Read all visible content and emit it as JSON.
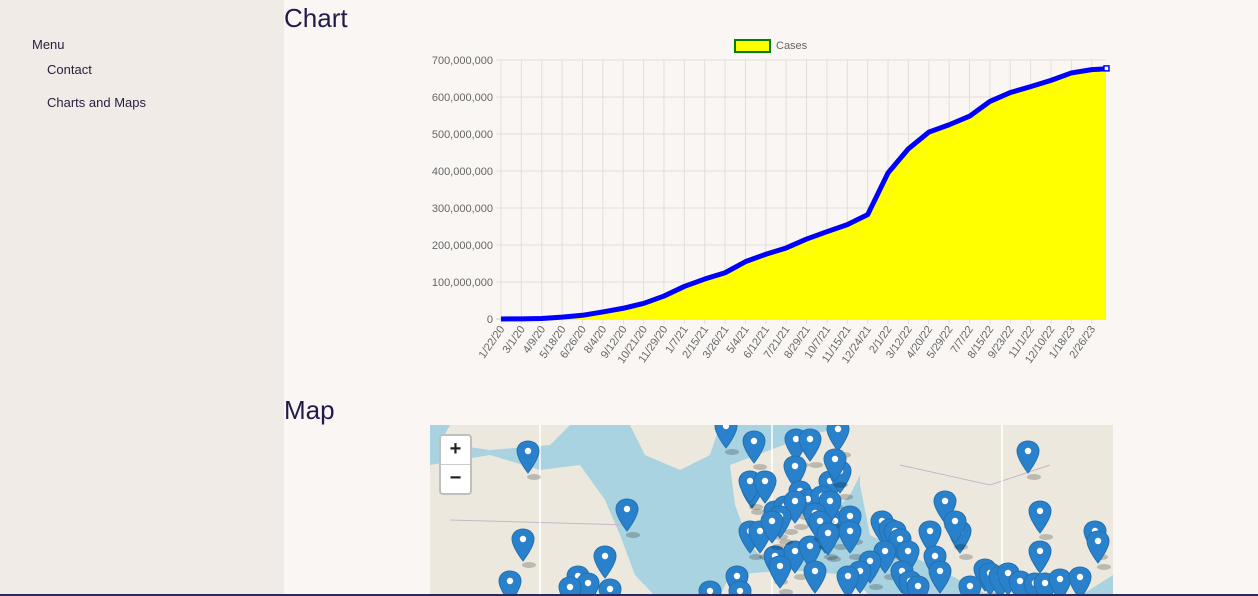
{
  "sidebar": {
    "menu_title": "Menu",
    "items": [
      {
        "label": "Contact"
      },
      {
        "label": "Charts and Maps"
      }
    ]
  },
  "sections": {
    "chart_heading": "Chart",
    "map_heading": "Map"
  },
  "map": {
    "zoom_in": "+",
    "zoom_out": "−",
    "marker_icon": "map-pin-icon"
  },
  "colors": {
    "area_fill": "#ffff00",
    "line": "#0000ff",
    "legend_border": "#008000",
    "marker": "#2a81cb"
  },
  "chart_data": {
    "type": "area",
    "legend": [
      "Cases"
    ],
    "legend_position": "top",
    "grid": true,
    "ylim": [
      0,
      700000000
    ],
    "y_ticks": [
      "0",
      "100,000,000",
      "200,000,000",
      "300,000,000",
      "400,000,000",
      "500,000,000",
      "600,000,000",
      "700,000,000"
    ],
    "x_ticks": [
      "1/22/20",
      "3/1/20",
      "4/9/20",
      "5/18/20",
      "6/26/20",
      "8/4/20",
      "9/12/20",
      "10/21/20",
      "11/29/20",
      "1/7/21",
      "2/15/21",
      "3/26/21",
      "5/4/21",
      "6/12/21",
      "7/21/21",
      "8/29/21",
      "10/7/21",
      "11/15/21",
      "12/24/21",
      "2/1/22",
      "3/12/22",
      "4/20/22",
      "5/29/22",
      "7/7/22",
      "8/15/22",
      "9/23/22",
      "11/1/22",
      "12/10/22",
      "1/18/23",
      "2/26/23"
    ],
    "series": [
      {
        "name": "Cases",
        "x": [
          "1/22/20",
          "3/1/20",
          "4/9/20",
          "5/18/20",
          "6/26/20",
          "8/4/20",
          "9/12/20",
          "10/21/20",
          "11/29/20",
          "1/7/21",
          "2/15/21",
          "3/26/21",
          "5/4/21",
          "6/12/21",
          "7/21/21",
          "8/29/21",
          "10/7/21",
          "11/15/21",
          "12/24/21",
          "2/1/22",
          "3/12/22",
          "4/20/22",
          "5/29/22",
          "7/7/22",
          "8/15/22",
          "9/23/22",
          "11/1/22",
          "12/10/22",
          "1/18/23",
          "2/26/23",
          "3/9/23"
        ],
        "values": [
          0,
          500000,
          1500000,
          5000000,
          10000000,
          19000000,
          29000000,
          42000000,
          62000000,
          88000000,
          108000000,
          125000000,
          155000000,
          175000000,
          192000000,
          216000000,
          236000000,
          255000000,
          282000000,
          395000000,
          460000000,
          505000000,
          525000000,
          548000000,
          588000000,
          612000000,
          628000000,
          645000000,
          665000000,
          674000000,
          676000000
        ]
      }
    ]
  }
}
